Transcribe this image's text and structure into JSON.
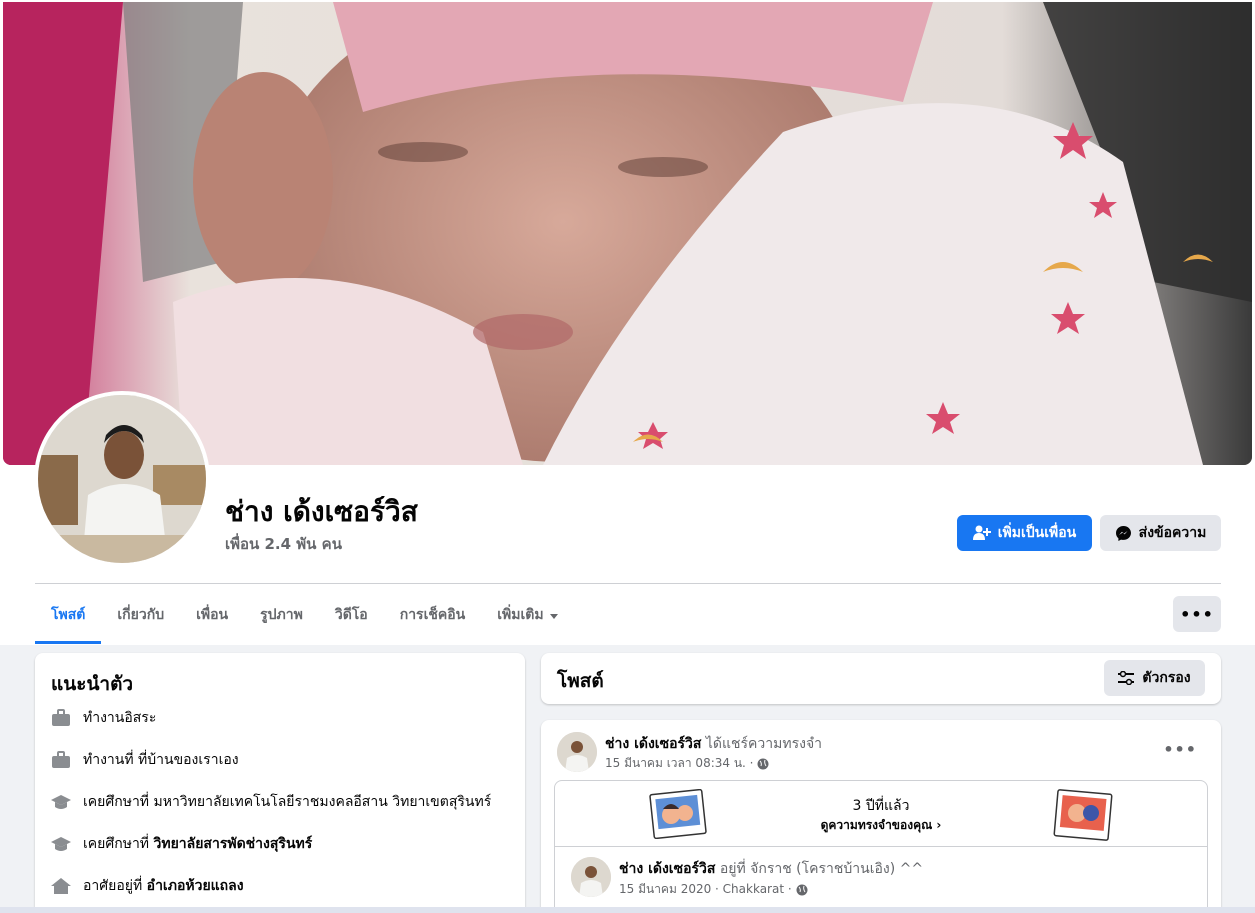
{
  "profile": {
    "name": "ช่าง เด้งเซอร์วิส",
    "friends": "เพื่อน 2.4 พัน คน"
  },
  "actions": {
    "add_friend": "เพิ่มเป็นเพื่อน",
    "message": "ส่งข้อความ",
    "more": "•••"
  },
  "tabs": [
    {
      "label": "โพสต์",
      "active": true
    },
    {
      "label": "เกี่ยวกับ"
    },
    {
      "label": "เพื่อน"
    },
    {
      "label": "รูปภาพ"
    },
    {
      "label": "วิดีโอ"
    },
    {
      "label": "การเช็คอิน"
    },
    {
      "label": "เพิ่มเติม"
    }
  ],
  "intro": {
    "title": "แนะนำตัว",
    "items": [
      {
        "icon": "briefcase-icon",
        "text": "ทำงานอิสระ",
        "bold": ""
      },
      {
        "icon": "briefcase-icon",
        "text": "ทำงานที่ ที่บ้านของเราเอง",
        "bold": ""
      },
      {
        "icon": "graduation-cap-icon",
        "text": "เคยศึกษาที่ มหาวิทยาลัยเทคโนโลยีราชมงคลอีสาน วิทยาเขตสุรินทร์",
        "bold": ""
      },
      {
        "icon": "graduation-cap-icon",
        "text": "เคยศึกษาที่ ",
        "bold": "วิทยาลัยสารพัดช่างสุรินทร์"
      },
      {
        "icon": "home-icon",
        "text": "อาศัยอยู่ที่ ",
        "bold": "อำเภอห้วยแถลง"
      }
    ]
  },
  "posts": {
    "title": "โพสต์",
    "filter": "ตัวกรอง"
  },
  "post": {
    "author": "ช่าง เด้งเซอร์วิส",
    "action": " ได้แชร์ความทรงจำ",
    "meta": "15 มีนาคม เวลา 08:34 น. ·",
    "memory_years": "3 ปีที่แล้ว",
    "memory_link": "ดูความทรงจำของคุณ",
    "inner_author": "ช่าง เด้งเซอร์วิส",
    "inner_action": " อยู่ที่ จักราช (โคราชบ้านเอิง) ^^",
    "inner_meta": "15 มีนาคม 2020 · Chakkarat ·"
  },
  "colors": {
    "accent": "#1877f2",
    "background": "#f0f2f5",
    "secondary_text": "#65676b"
  }
}
